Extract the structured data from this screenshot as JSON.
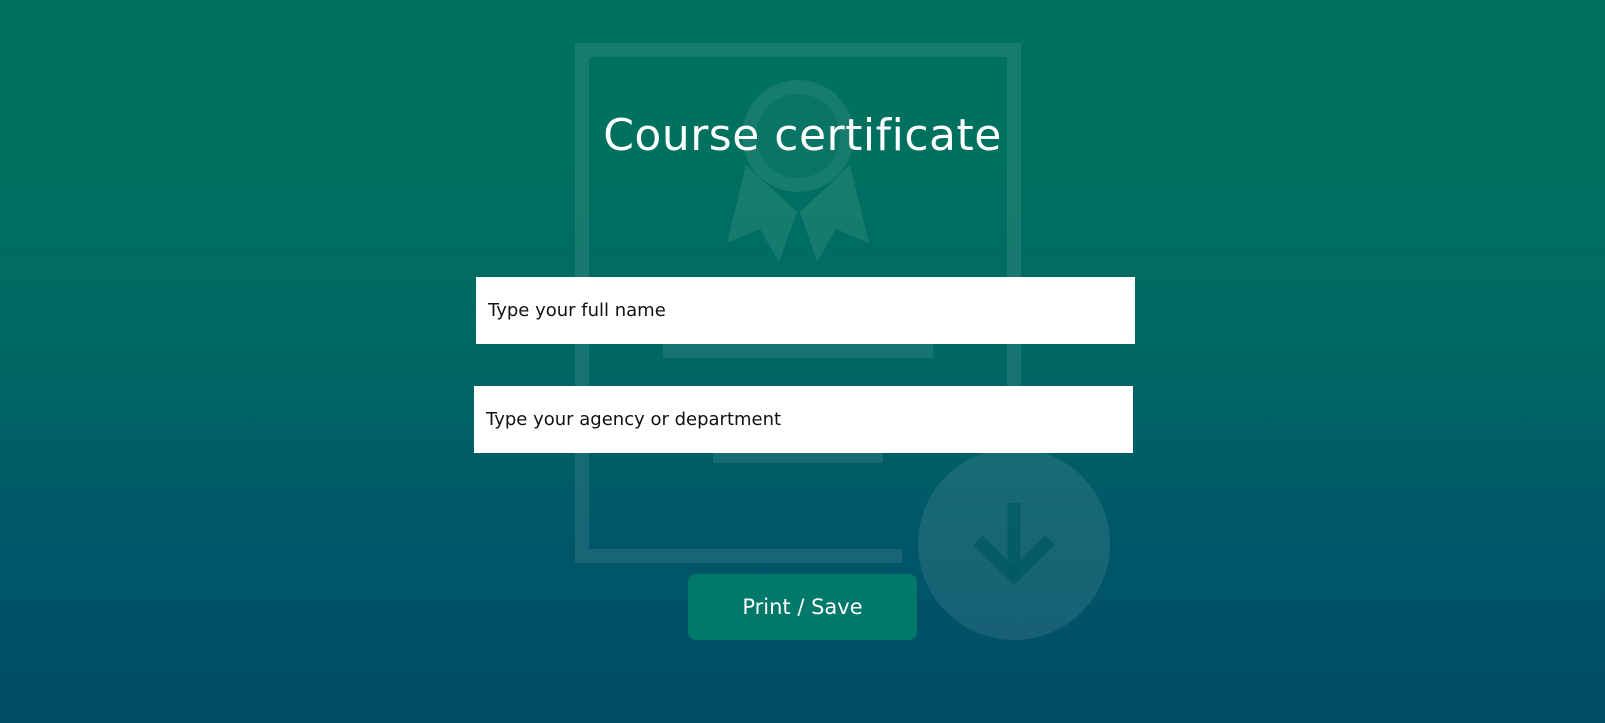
{
  "page": {
    "title": "Course certificate"
  },
  "form": {
    "name_placeholder": "Type your full name",
    "agency_placeholder": "Type your agency or department",
    "name_value": "",
    "agency_value": ""
  },
  "actions": {
    "print_label": "Print / Save"
  },
  "background": {
    "icons": [
      "certificate-icon",
      "award-ribbon-icon",
      "download-arrow-icon"
    ]
  },
  "colors": {
    "gradient_top": "#00705f",
    "gradient_bottom": "#004c66",
    "button": "#00786a",
    "text": "#ffffff"
  }
}
